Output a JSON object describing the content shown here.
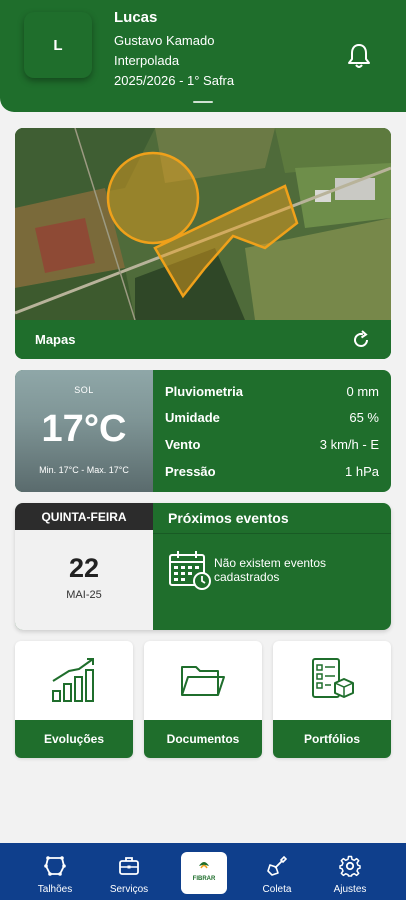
{
  "header": {
    "avatar_initial": "L",
    "name": "Lucas",
    "farm": "Gustavo Kamado",
    "location": "Interpolada",
    "season": "2025/2026 - 1° Safra",
    "bell_icon": "bell-icon"
  },
  "map": {
    "label": "Mapas",
    "refresh_icon": "refresh-icon"
  },
  "weather": {
    "condition": "SOL",
    "temperature": "17°C",
    "range": "Min. 17°C - Max. 17°C",
    "rows": [
      {
        "label": "Pluviometria",
        "value": "0 mm"
      },
      {
        "label": "Umidade",
        "value": "65 %"
      },
      {
        "label": "Vento",
        "value": "3 km/h - E"
      },
      {
        "label": "Pressão",
        "value": "1 hPa"
      }
    ]
  },
  "date": {
    "weekday": "QUINTA-FEIRA",
    "day": "22",
    "month": "MAI-25"
  },
  "events": {
    "title": "Próximos eventos",
    "empty_text": "Não existem eventos cadastrados",
    "icon": "calendar-clock-icon"
  },
  "shortcuts": [
    {
      "label": "Evoluções",
      "icon": "bar-chart-icon"
    },
    {
      "label": "Documentos",
      "icon": "folder-icon"
    },
    {
      "label": "Portfólios",
      "icon": "checklist-box-icon"
    }
  ],
  "nav": {
    "items": [
      {
        "label": "Talhões",
        "icon": "field-icon"
      },
      {
        "label": "Serviços",
        "icon": "briefcase-icon"
      },
      {
        "label": "Coleta",
        "icon": "shovel-icon"
      },
      {
        "label": "Ajustes",
        "icon": "gear-icon"
      }
    ],
    "center_brand": "FIBRAR",
    "center_icon": "brand-logo-icon"
  },
  "colors": {
    "primary_green": "#1f6e2c",
    "nav_blue": "#0f3f8c",
    "field_outline": "#f0a11a"
  }
}
